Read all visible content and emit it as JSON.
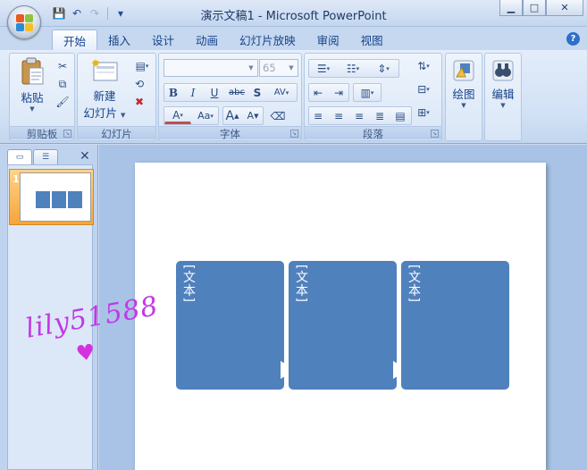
{
  "window": {
    "title": "演示文稿1 - Microsoft PowerPoint",
    "controls": {
      "minimize": "▁",
      "maximize": "□",
      "close": "✕"
    }
  },
  "quick_access": {
    "save_icon": "💾",
    "undo_icon": "↶",
    "redo_icon": "↷",
    "customize_icon": "▾"
  },
  "tabs": [
    "开始",
    "插入",
    "设计",
    "动画",
    "幻灯片放映",
    "审阅",
    "视图"
  ],
  "active_tab": "开始",
  "help_label": "?",
  "ribbon": {
    "clipboard": {
      "label": "剪贴板",
      "paste_label": "粘贴"
    },
    "slides": {
      "label": "幻灯片",
      "new_slide_line1": "新建",
      "new_slide_line2": "幻灯片"
    },
    "font": {
      "label": "字体",
      "font_name": "",
      "font_size": "65",
      "bold": "B",
      "italic": "I",
      "underline": "U",
      "strike": "abc",
      "shadow": "S",
      "spacing": "AV",
      "font_color": "A",
      "change_case": "Aa",
      "grow": "A",
      "shrink": "A"
    },
    "paragraph": {
      "label": "段落"
    },
    "drawing": {
      "label": "绘图"
    },
    "editing": {
      "label": "编辑"
    }
  },
  "slide_panel": {
    "slide_number": "1",
    "close_icon": "✕"
  },
  "slide": {
    "blocks": [
      {
        "text": "[文本]"
      },
      {
        "text": "[文本]"
      },
      {
        "text": "[文本]"
      }
    ]
  },
  "watermark": {
    "text": "lily51588",
    "heart": "♥"
  },
  "colors": {
    "shape_fill": "#4f81bd",
    "ribbon_bg": "#d1e1f5",
    "selected_thumb": "#f5a53a"
  }
}
